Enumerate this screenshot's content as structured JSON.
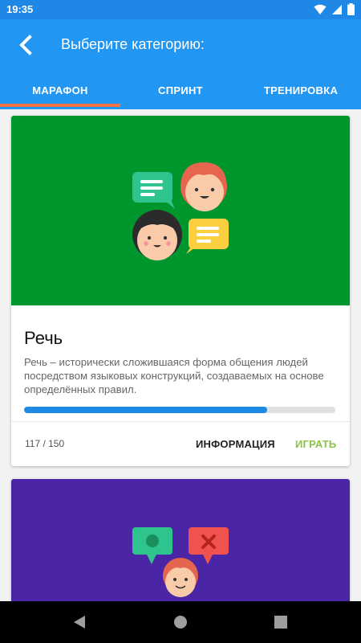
{
  "status_bar": {
    "time": "19:35",
    "icons": [
      "wifi-icon",
      "signal-icon",
      "battery-icon"
    ]
  },
  "app_bar": {
    "title": "Выберите категорию:",
    "back_icon": "back-arrow-icon"
  },
  "tabs": [
    {
      "label": "МАРАФОН",
      "selected": true
    },
    {
      "label": "СПРИНТ",
      "selected": false
    },
    {
      "label": "ТРЕНИРОВКА",
      "selected": false
    }
  ],
  "cards": [
    {
      "title": "Речь",
      "description": "Речь – исторически сложившаяся форма общения людей посредством языковых конструкций, создаваемых на основе определённых правил.",
      "progress": 0.78,
      "counter": "117 / 150",
      "info_label": "ИНФОРМАЦИЯ",
      "play_label": "ИГРАТЬ",
      "hero_color": "#00962e"
    },
    {
      "hero_color": "#4a25a5"
    }
  ],
  "colors": {
    "primary": "#2196f3",
    "status_bar": "#1f87e5",
    "tab_indicator": "#ff7043",
    "progress": "#1e88e5",
    "play_button": "#8bc34a"
  },
  "nav_bar": {
    "icons": [
      "back-triangle-icon",
      "home-circle-icon",
      "recents-square-icon"
    ]
  }
}
